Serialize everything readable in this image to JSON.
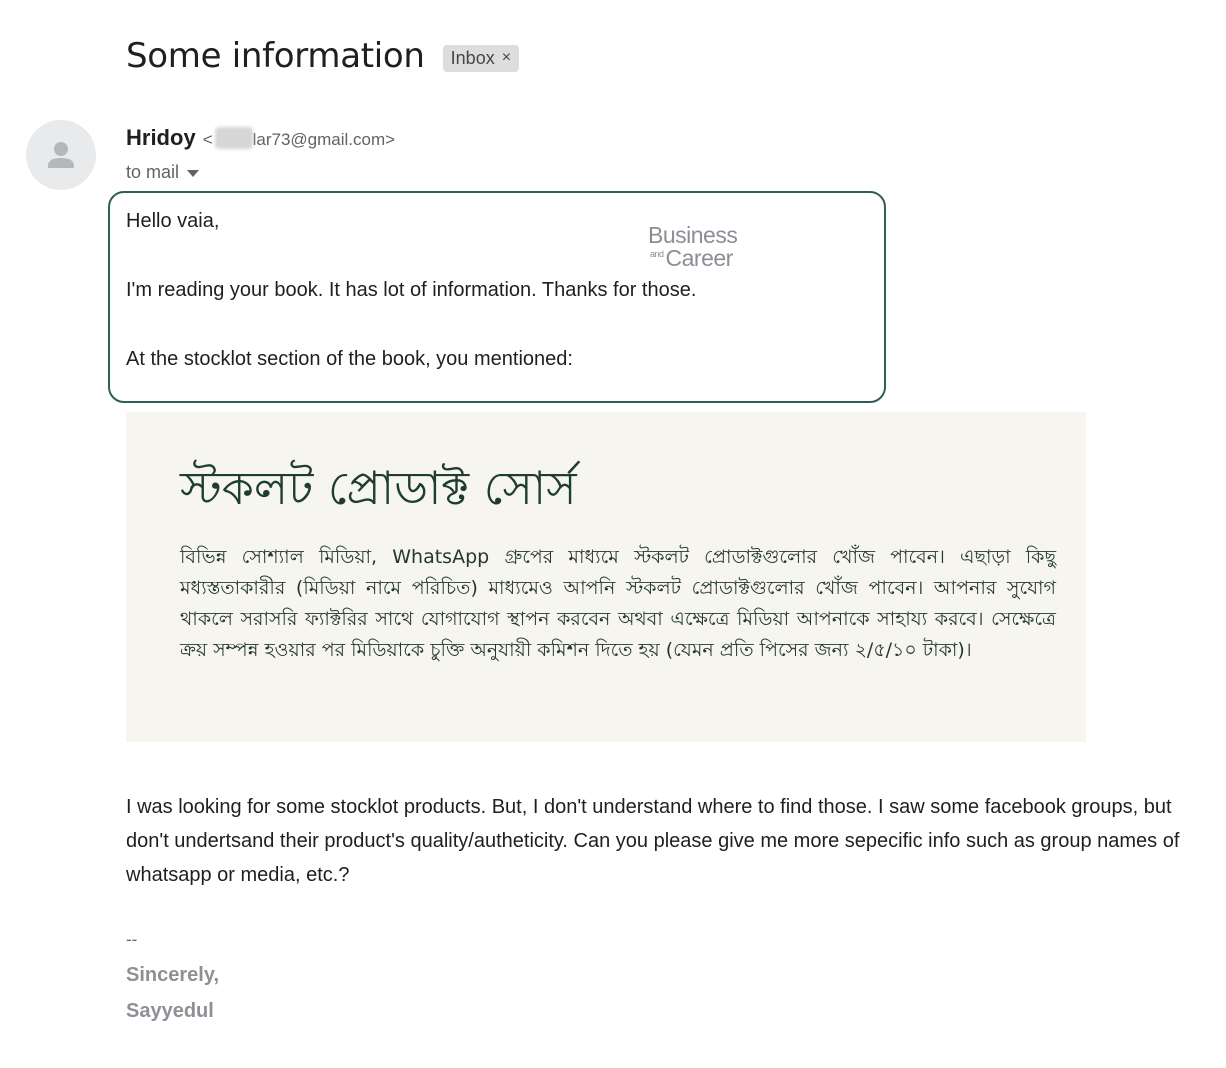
{
  "email": {
    "subject": "Some information",
    "label": "Inbox",
    "label_close": "×",
    "sender_name": "Hridoy",
    "sender_email_open": "<",
    "sender_email_visible": "lar73@gmail.com>",
    "recipient": "to mail",
    "body": {
      "greeting": "Hello vaia,",
      "line1": "I'm reading your book. It has lot of information. Thanks for those.",
      "line2": "At the stocklot section of the book, you mentioned:",
      "question": "I was looking for some stocklot products. But, I don't understand where to find those. I saw some facebook groups, but don't undertsand their product's quality/autheticity. Can you please give me more sepecific info such as group names of whatsapp or media, etc.?"
    },
    "signature": {
      "dash": "--",
      "closing": "Sincerely,",
      "name": "Sayyedul"
    }
  },
  "watermark": {
    "line1": "Business",
    "and": "and",
    "line2": "Career"
  },
  "book_excerpt": {
    "title": "স্টকলট প্রোডাক্ট সোর্স",
    "paragraph": "বিভিন্ন সোশ্যাল মিডিয়া, WhatsApp গ্রুপের মাধ্যমে স্টকলট প্রোডাক্টগুলোর খোঁজ পাবেন। এছাড়া কিছু মধ্যস্ততাকারীর (মিডিয়া নামে পরিচিত) মাধ্যমেও আপনি স্টকলট প্রোডাক্টগুলোর খোঁজ পাবেন। আপনার সুযোগ থাকলে সরাসরি ফ্যাক্টরির সাথে যোগাযোগ স্থাপন করবেন অথবা এক্ষেত্রে মিডিয়া আপনাকে সাহায্য করবে। সেক্ষেত্রে ক্রয় সম্পন্ন হওয়ার পর মিডিয়াকে চুক্তি অনুযায়ী কমিশন দিতে হয় (যেমন প্রতি পিসের জন্য ২/৫/১০ টাকা)।"
  },
  "colors": {
    "highlight_border": "#2e5f4f",
    "book_background": "#f6f5ef",
    "book_text": "#1f3d2f"
  },
  "icons": {
    "avatar": "person-icon",
    "recipient_details": "caret-down-icon",
    "label_remove": "close-icon"
  }
}
